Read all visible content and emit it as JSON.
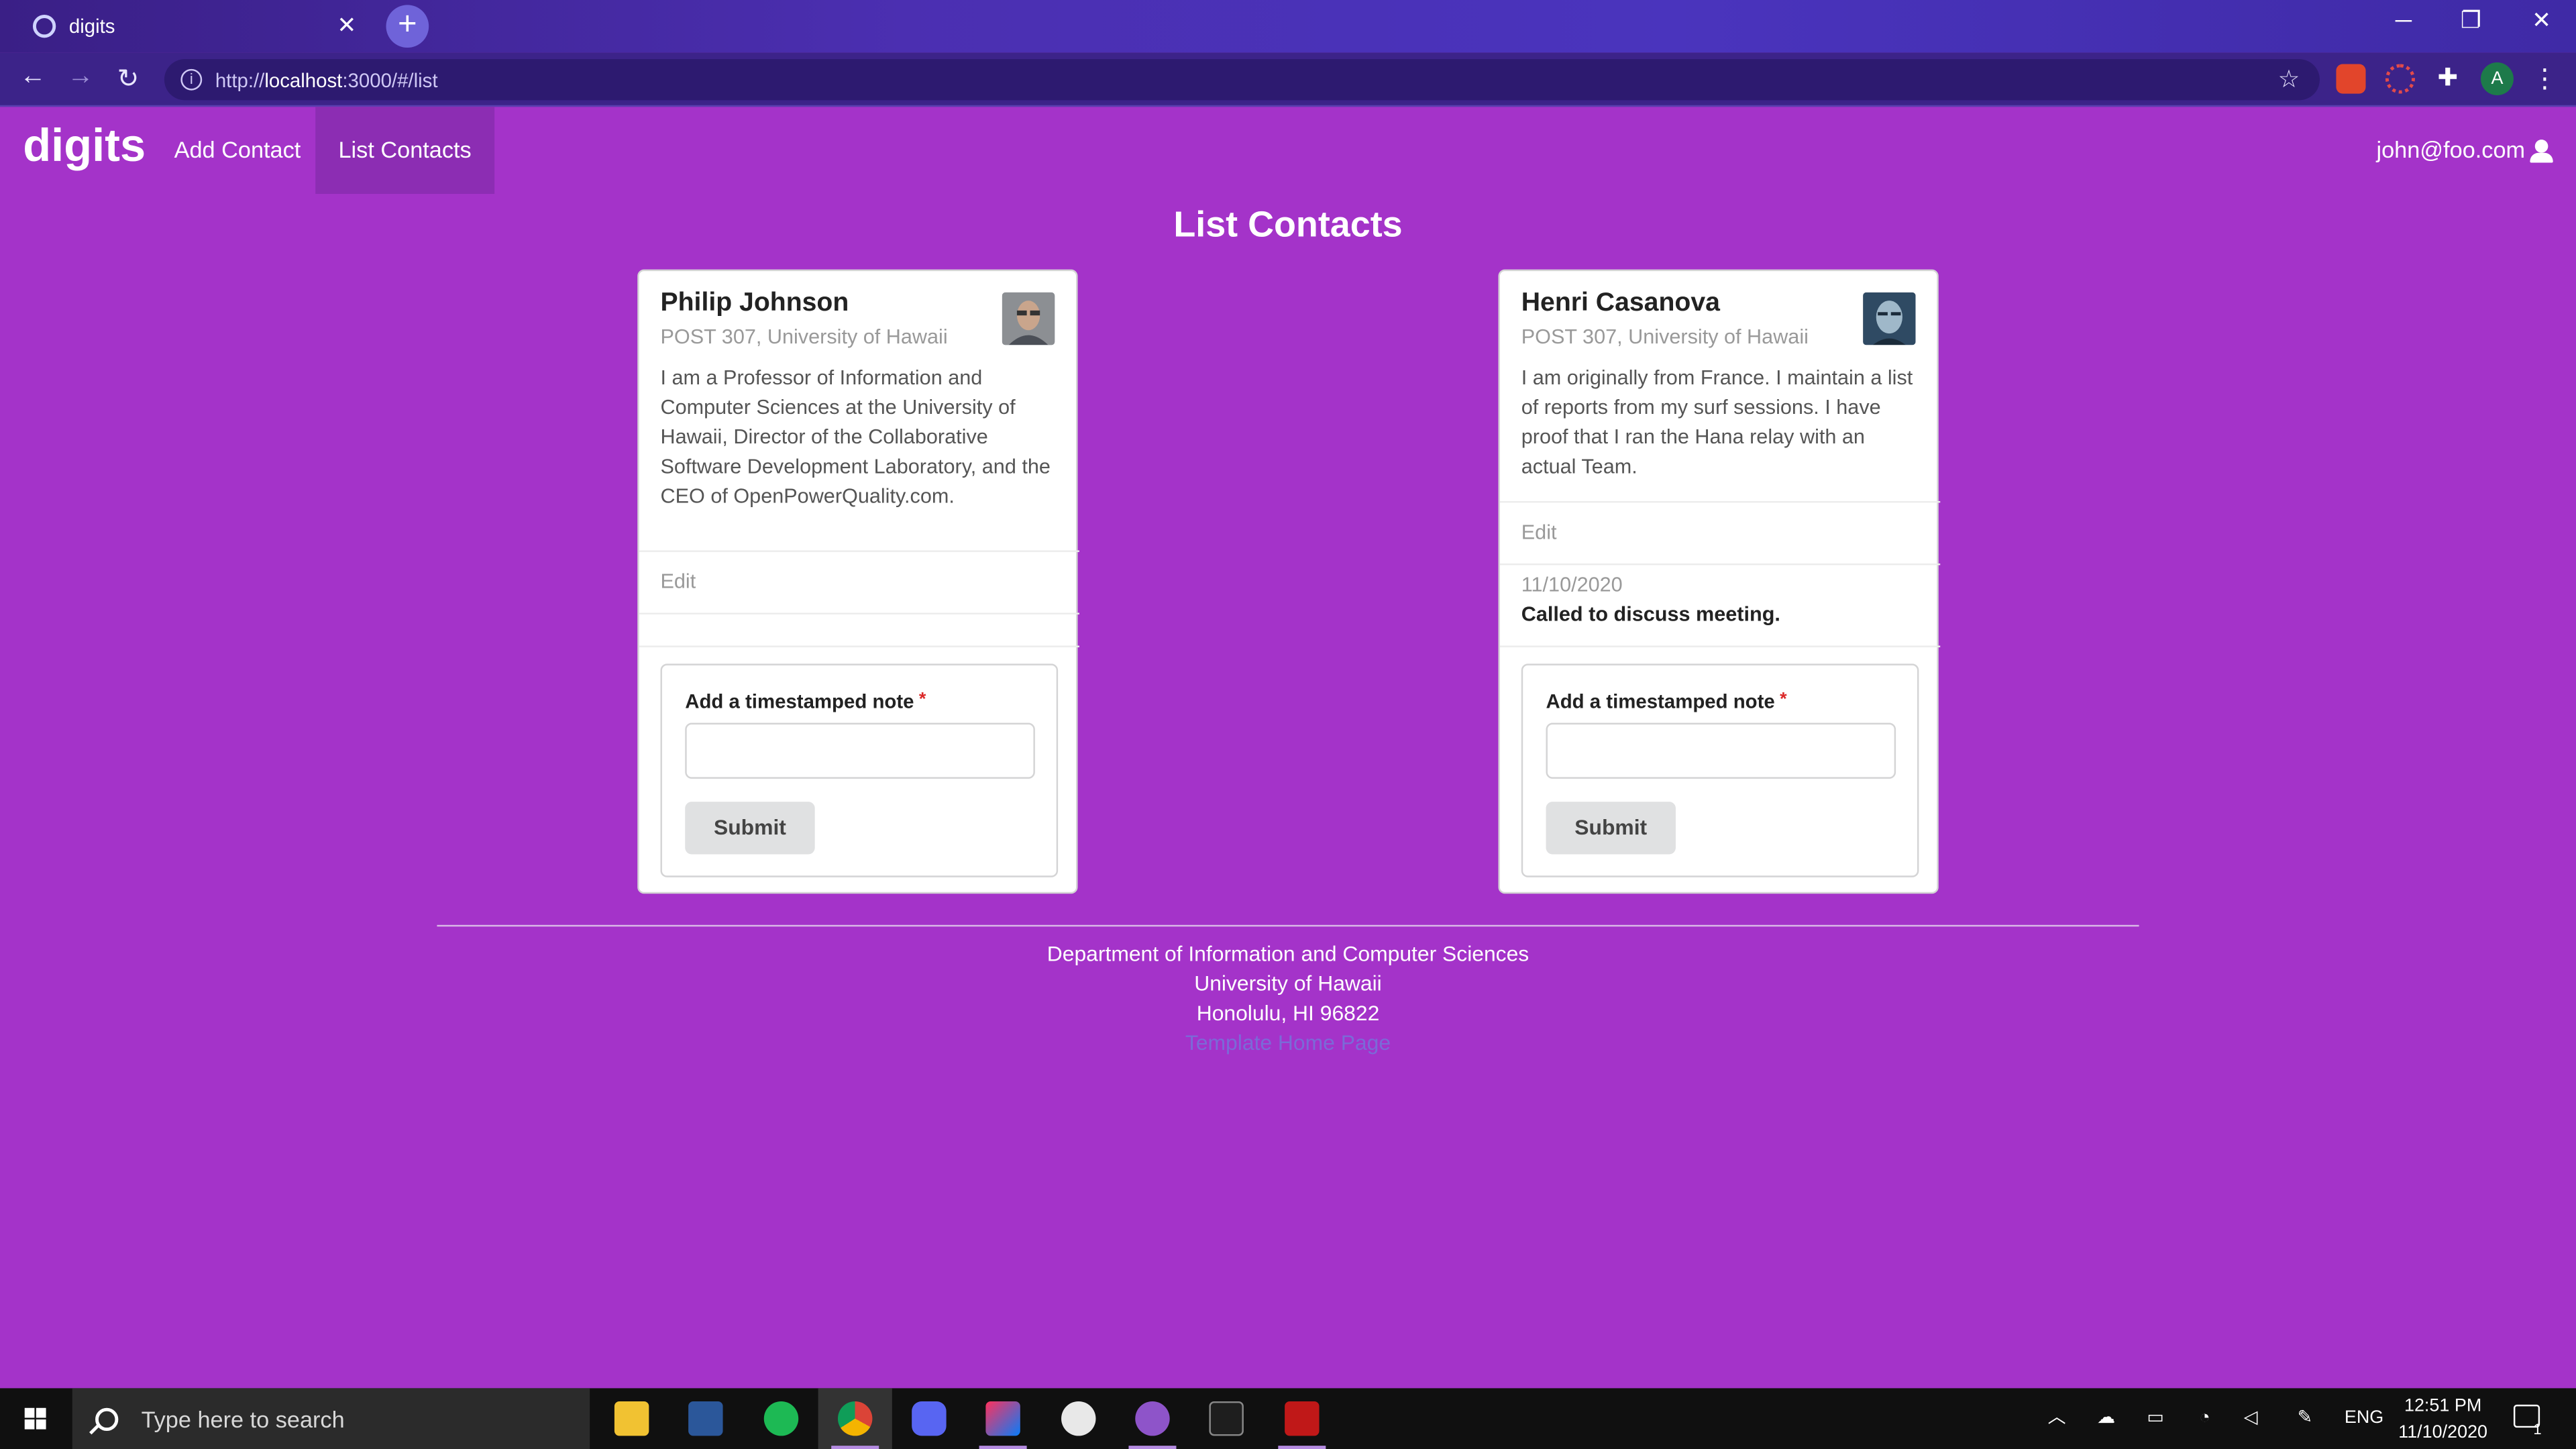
{
  "browser": {
    "tab_title": "digits",
    "tab_close": "✕",
    "new_tab": "+",
    "url_base": "http://",
    "url_host": "localhost",
    "url_rest": ":3000/#/list",
    "controls": {
      "minimize": "─",
      "restore": "❐",
      "close": "✕"
    },
    "profile_initial": "A"
  },
  "app": {
    "brand": "digits",
    "menu": [
      {
        "label": "Add Contact",
        "active": false
      },
      {
        "label": "List Contacts",
        "active": true
      }
    ],
    "user": "john@foo.com"
  },
  "page": {
    "title": "List Contacts",
    "contacts": [
      {
        "name": "Philip Johnson",
        "address": "POST 307, University of Hawaii",
        "description": "I am a Professor of Information and Computer Sciences at the University of Hawaii, Director of the Collaborative Software Development Laboratory, and the CEO of OpenPowerQuality.com.",
        "edit_label": "Edit",
        "notes": [],
        "form": {
          "label": "Add a timestamped note",
          "required_mark": "*",
          "value": "",
          "submit_label": "Submit"
        }
      },
      {
        "name": "Henri Casanova",
        "address": "POST 307, University of Hawaii",
        "description": "I am originally from France. I maintain a list of reports from my surf sessions. I have proof that I ran the Hana relay with an actual Team.",
        "edit_label": "Edit",
        "notes": [
          {
            "date": "11/10/2020",
            "text": "Called to discuss meeting."
          }
        ],
        "form": {
          "label": "Add a timestamped note",
          "required_mark": "*",
          "value": "",
          "submit_label": "Submit"
        }
      }
    ]
  },
  "footer": {
    "line1": "Department of Information and Computer Sciences",
    "line2": "University of Hawaii",
    "line3": "Honolulu, HI 96822",
    "link": "Template Home Page"
  },
  "taskbar": {
    "search_placeholder": "Type here to search",
    "language": "ENG",
    "time": "12:51 PM",
    "date": "11/10/2020",
    "notification_count": "1",
    "apps": [
      {
        "name": "file-explorer",
        "color": "#f1c232"
      },
      {
        "name": "word",
        "color": "#2b579a"
      },
      {
        "name": "spotify",
        "color": "#1db954"
      },
      {
        "name": "chrome",
        "color": "#db4437"
      },
      {
        "name": "discord",
        "color": "#5865f2"
      },
      {
        "name": "intellij",
        "color": "#fe315d"
      },
      {
        "name": "clock-app",
        "color": "#e8e8e8"
      },
      {
        "name": "github-desktop",
        "color": "#8e54c9"
      },
      {
        "name": "terminal",
        "color": "#1e1e1e"
      },
      {
        "name": "mcafee",
        "color": "#c01818"
      }
    ]
  },
  "colors": {
    "page_bg": "#a433c9",
    "active_menu": "#8c2db3",
    "card_bg": "#ffffff"
  }
}
